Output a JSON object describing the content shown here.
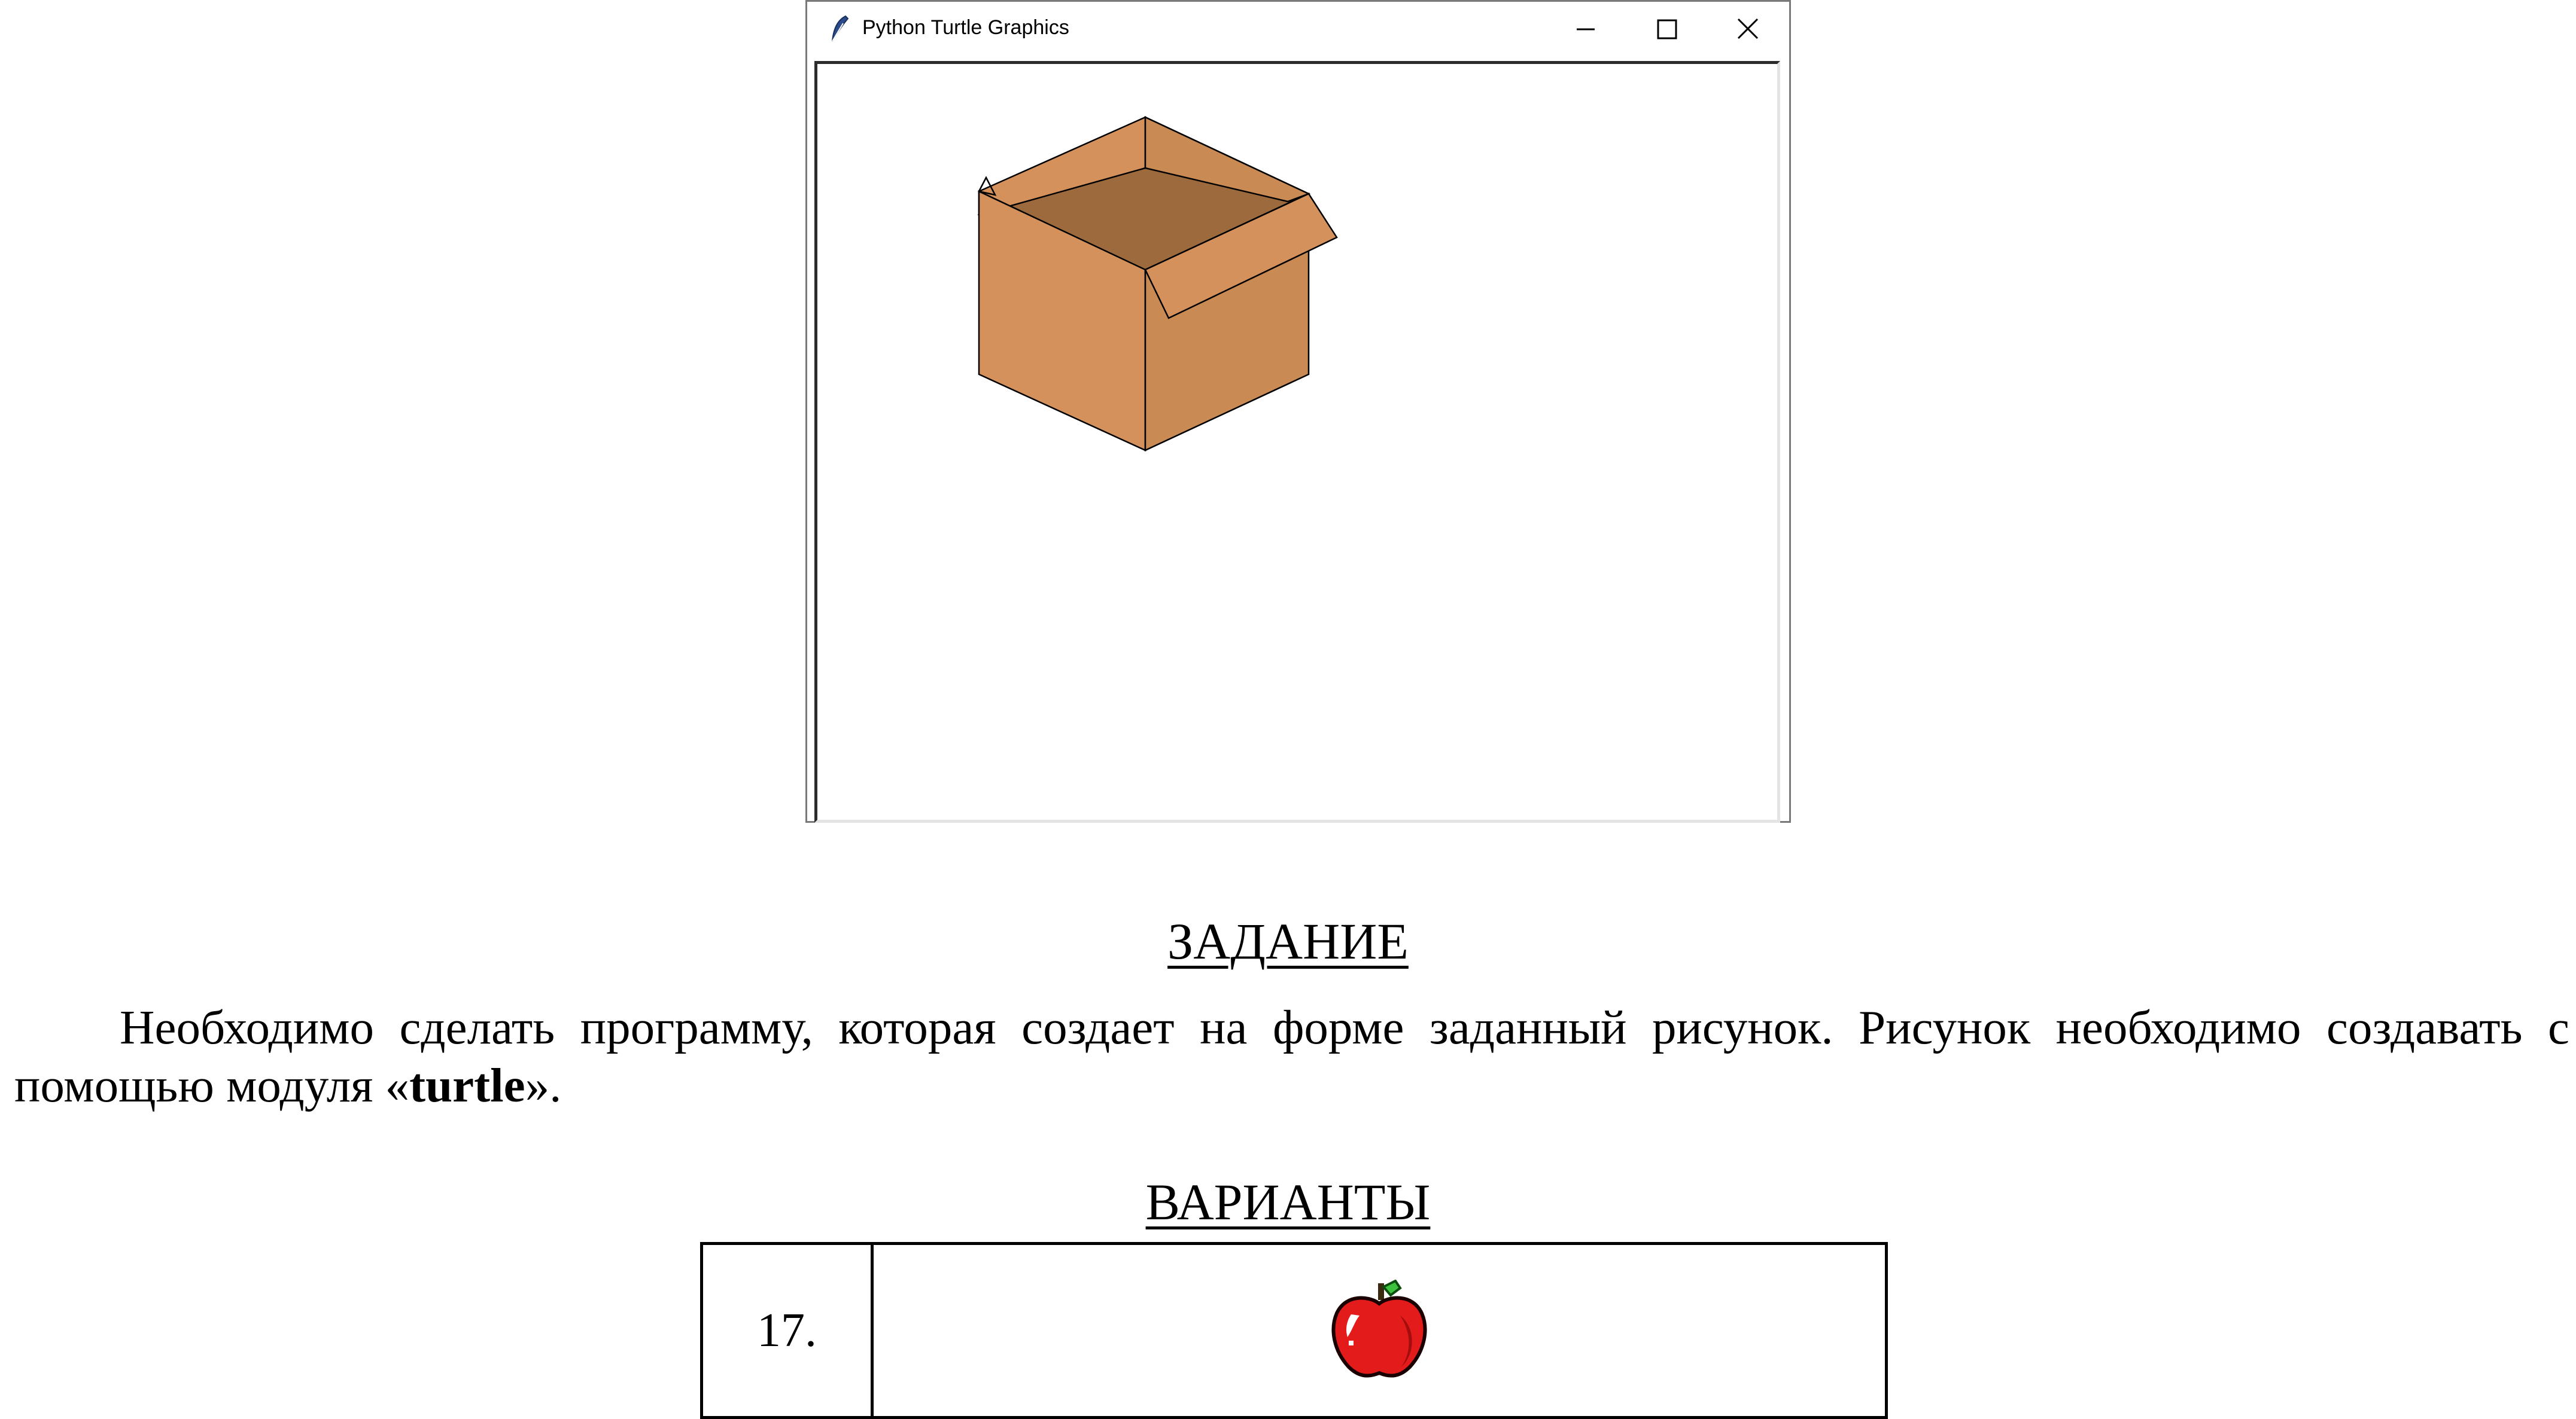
{
  "window": {
    "title": "Python Turtle Graphics",
    "icon": "feather-icon",
    "buttons": [
      "minimize-icon",
      "maximize-icon",
      "close-icon"
    ]
  },
  "drawing": {
    "subject": "open cardboard box",
    "colors": {
      "front_left": "#d4915c",
      "front_right": "#c98a54",
      "inside": "#9c6a3d",
      "flap": "#d4915c",
      "outline": "#000000"
    }
  },
  "task": {
    "heading": "ЗАДАНИЕ",
    "text_before": "Необходимо сделать программу, которая создает на форме заданный рисунок. Рисунок необходимо создавать с помощью модуля «",
    "module": "turtle",
    "text_after": "»."
  },
  "variants": {
    "heading": "ВАРИАНТЫ",
    "rows": [
      {
        "number": "17.",
        "picture": "apple-icon"
      }
    ]
  }
}
